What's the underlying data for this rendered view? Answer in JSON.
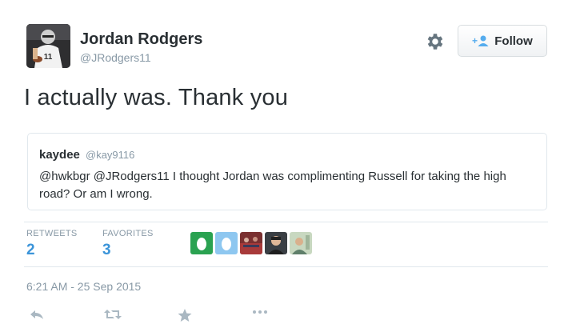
{
  "author": {
    "name": "Jordan Rodgers",
    "handle": "@JRodgers11",
    "avatar_icon": "football-player-avatar"
  },
  "follow_button": {
    "label": "Follow",
    "icon": "add-user-icon"
  },
  "tweet": {
    "text": "I actually was. Thank you"
  },
  "quoted": {
    "name": "kaydee",
    "handle": "@kay9116",
    "text": "@hwkbgr @JRodgers11 I thought Jordan was complimenting  Russell  for taking the high road? Or am I wrong."
  },
  "stats": {
    "retweets_label": "RETWEETS",
    "retweets_value": "2",
    "favorites_label": "FAVORITES",
    "favorites_value": "3"
  },
  "favoriter_avatars": [
    "green-egg-avatar",
    "blue-egg-avatar",
    "crowd-avatar",
    "person-avatar",
    "outdoor-avatar"
  ],
  "timestamp": "6:21 AM - 25 Sep 2015",
  "actions": [
    "reply-icon",
    "retweet-icon",
    "favorite-icon",
    "more-icon"
  ],
  "colors": {
    "link": "#3b94d9",
    "muted": "#8899a6",
    "text": "#292f33",
    "border": "#e1e8ed",
    "egg_green": "#2aa251",
    "egg_blue": "#55acee"
  }
}
